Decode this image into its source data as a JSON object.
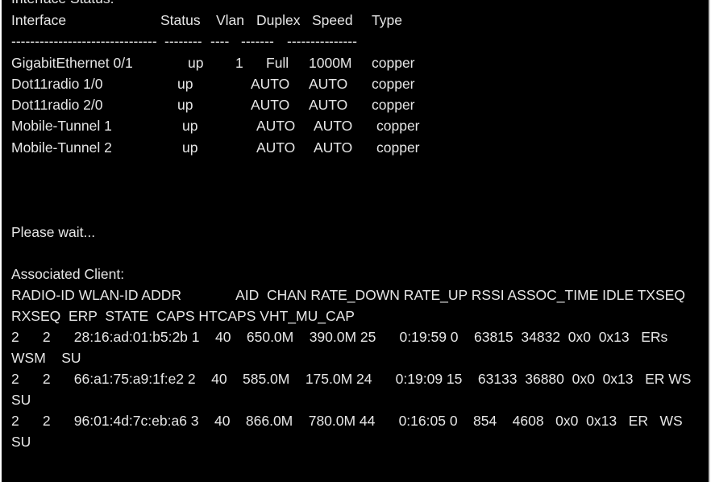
{
  "terminal": {
    "cut_heading": "Interface Status:",
    "interface_table": {
      "headers": [
        "Interface",
        "Status",
        "Vlan",
        "Duplex",
        "Speed",
        "Type"
      ],
      "separators": [
        "-------------------------------",
        "--------",
        "----",
        "-------",
        "---------",
        "------"
      ],
      "rows": [
        [
          "GigabitEthernet 0/1",
          "up",
          "1",
          "Full",
          "1000M",
          "copper"
        ],
        [
          "Dot11radio 1/0",
          "up",
          "",
          "AUTO",
          "AUTO",
          "copper"
        ],
        [
          "Dot11radio 2/0",
          "up",
          "",
          "AUTO",
          "AUTO",
          "copper"
        ],
        [
          "Mobile-Tunnel 1",
          "up",
          "",
          "AUTO",
          "AUTO",
          "copper"
        ],
        [
          "Mobile-Tunnel 2",
          "up",
          "",
          "AUTO",
          "AUTO",
          "copper"
        ]
      ]
    },
    "wait_message": "Please wait...",
    "clients_heading": "Associated Client:",
    "clients_header": "RADIO-ID WLAN-ID ADDR              AID  CHAN RATE_DOWN RATE_UP RSSI ASSOC_TIME IDLE TXSEQ RXSEQ  ERP  STATE  CAPS HTCAPS VHT_MU_CAP",
    "clients": [
      "2      2      28:16:ad:01:b5:2b 1    40    650.0M    390.0M 25      0:19:59 0    63815  34832  0x0  0x13   ERs WSM    SU",
      "2      2      66:a1:75:a9:1f:e2 2    40    585.0M    175.0M 24      0:19:09 15    63133  36880  0x0  0x13   ER WS      SU",
      "2      2      96:01:4d:7c:eb:a6 3    40    866.0M    780.0M 44      0:16:05 0    854    4608   0x0  0x13   ER   WS SU"
    ]
  }
}
